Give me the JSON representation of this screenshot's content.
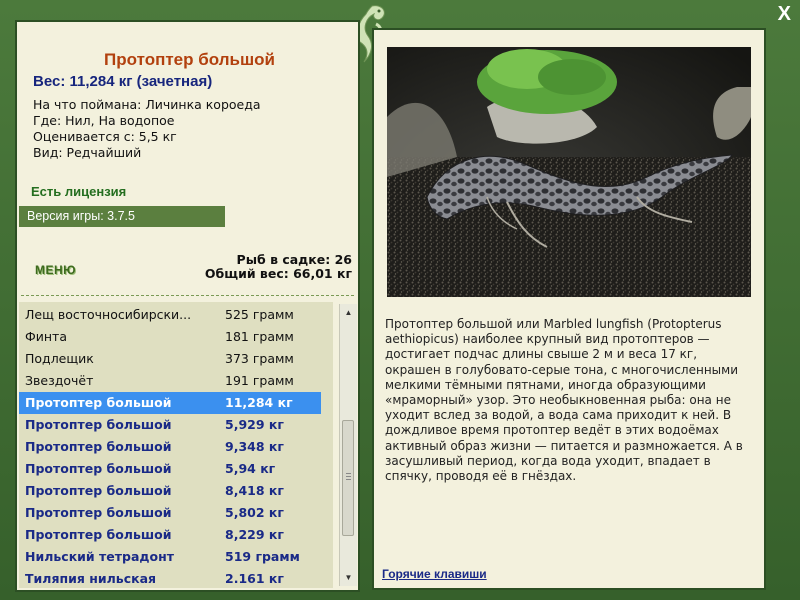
{
  "window": {
    "close_label": "X"
  },
  "fish": {
    "title": "Протоптер большой",
    "weight": "Вес: 11,284 кг (зачетная)",
    "bait": "На что поймана: Личинка короеда",
    "location": "Где: Нил, На водопое",
    "valued_from": "Оценивается с: 5,5 кг",
    "type": "Вид: Редчайший"
  },
  "license": "Есть лицензия",
  "version": "Версия игры: 3.7.5",
  "menu_label": "МЕНЮ",
  "stats": {
    "fish_in_keepnet": "Рыб в садке: 26",
    "total_weight": "Общий вес: 66,01 кг"
  },
  "catch_list": [
    {
      "name": "Лещ восточносибирски...",
      "weight": "525 грамм",
      "style": "normal"
    },
    {
      "name": "Финта",
      "weight": "181 грамм",
      "style": "normal"
    },
    {
      "name": "Подлещик",
      "weight": "373 грамм",
      "style": "normal"
    },
    {
      "name": "Звездочёт",
      "weight": "191 грамм",
      "style": "normal"
    },
    {
      "name": "Протоптер большой",
      "weight": "11,284 кг",
      "style": "selected"
    },
    {
      "name": "Протоптер большой",
      "weight": "5,929 кг",
      "style": "bold"
    },
    {
      "name": "Протоптер большой",
      "weight": "9,348 кг",
      "style": "bold"
    },
    {
      "name": "Протоптер большой",
      "weight": "5,94 кг",
      "style": "bold"
    },
    {
      "name": "Протоптер большой",
      "weight": "8,418 кг",
      "style": "bold"
    },
    {
      "name": "Протоптер большой",
      "weight": "5,802 кг",
      "style": "bold"
    },
    {
      "name": "Протоптер большой",
      "weight": "8,229 кг",
      "style": "bold"
    },
    {
      "name": "Нильский тетрадонт",
      "weight": "519 грамм",
      "style": "bold"
    },
    {
      "name": "Тиляпия нильская",
      "weight": "2.161 кг",
      "style": "bold"
    }
  ],
  "description": "Протоптер большой или Marbled lungfish (Protopterus aethiopicus) наиболее крупный вид протоптеров — достигает подчас длины свыше 2 м и веса 17 кг, окрашен в голубовато-серые тона, с многочисленными мелкими тёмными пятнами, иногда образующими «мраморный» узор. Это необыкновенная рыба: она не уходит вслед за водой, а вода сама приходит к ней. В дождливое время протоптер ведёт в этих водоёмах активный образ жизни — питается и размножается. А в засушливый период, когда вода уходит, впадает в спячку, проводя её в гнёздах.",
  "hotkeys_label": "Горячие клавиши",
  "icons": {
    "close": "close-icon",
    "logo": "dragon-logo-icon",
    "scroll_up": "scroll-up-icon",
    "scroll_down": "scroll-down-icon"
  },
  "colors": {
    "frame": "#3f6b33",
    "panel": "#f3f1dd",
    "title": "#b2410e",
    "accent_blue": "#1a2a87",
    "selection": "#3b90ef",
    "license": "#246e1f"
  }
}
